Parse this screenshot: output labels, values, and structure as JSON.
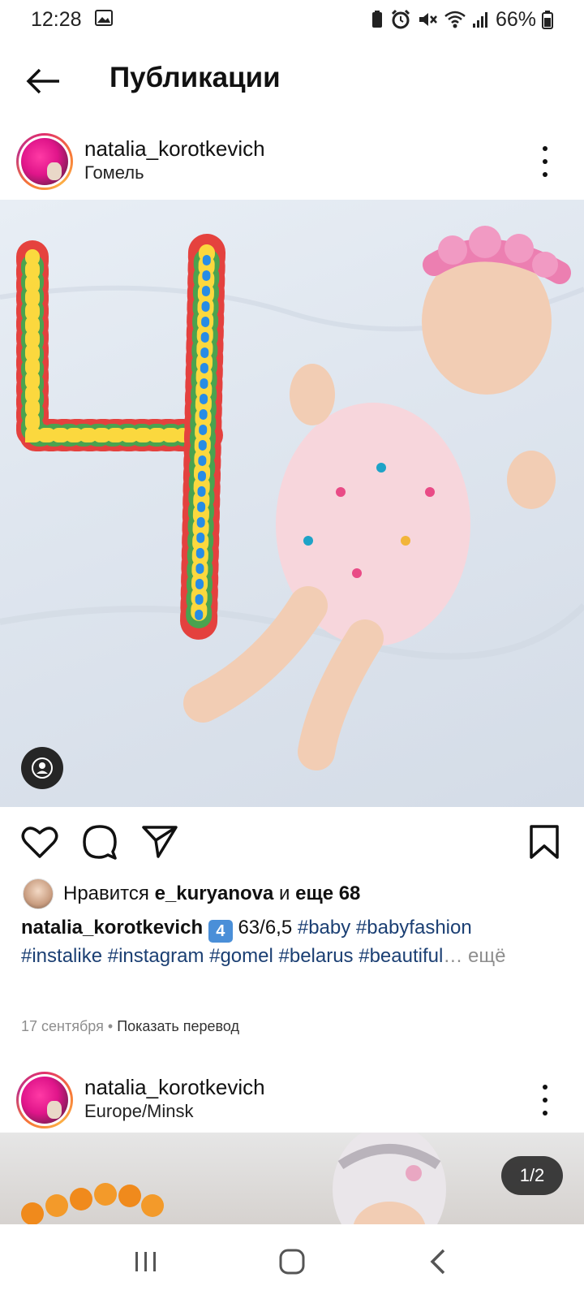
{
  "status_bar": {
    "time": "12:28",
    "battery": "66%"
  },
  "header": {
    "title": "Публикации"
  },
  "posts": [
    {
      "username": "natalia_korotkevich",
      "location": "Гомель",
      "likes": {
        "prefix": "Нравится",
        "user": "e_kuryanova",
        "middle": "и",
        "suffix": "еще 68"
      },
      "caption": {
        "user": "natalia_korotkevich",
        "emoji": "4",
        "text": "63/6,5",
        "tags_line1": "#baby #babyfashion",
        "tags_line2": "#instalike #instagram #gomel #belarus #beautiful",
        "ellipsis": "…",
        "more": "ещё"
      },
      "date": "17 сентября",
      "separator": "•",
      "translate": "Показать перевод"
    },
    {
      "username": "natalia_korotkevich",
      "location": "Europe/Minsk",
      "counter": "1/2"
    }
  ],
  "colors": {
    "hashtag": "#1b3f73",
    "muted": "#8e8e8e",
    "story_ring": "#e1306c"
  }
}
